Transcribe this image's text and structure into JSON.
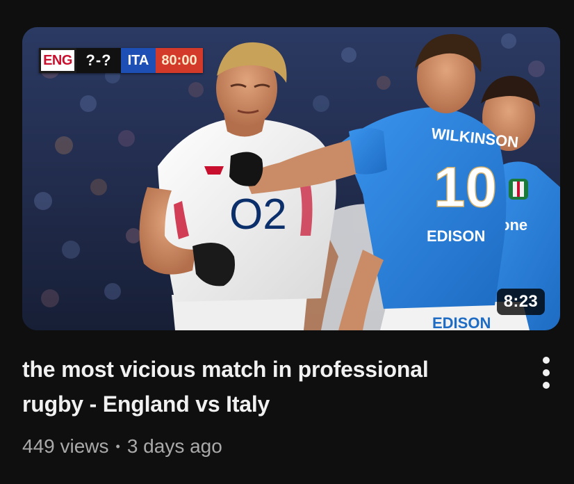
{
  "video": {
    "duration": "8:23",
    "title_line1": "the most vicious match in professional",
    "title_line2": "rugby - England vs Italy",
    "views": "449 views",
    "separator": "•",
    "age": "3 days ago"
  },
  "scorebug": {
    "home": "ENG",
    "score": "?-?",
    "away": "ITA",
    "clock": "80:00"
  },
  "thumbnail_text": {
    "jersey_name": "WILKINSON",
    "jersey_number": "10",
    "o2_logo": "O2",
    "sponsor_chest": "EDISON",
    "sponsor_shorts": "EDISON",
    "sleeve_text": "one"
  },
  "icons": {
    "menu": "more-vert-icon"
  },
  "colors": {
    "background": "#0f0f0f",
    "italy_blue": "#2a7fd6",
    "england_white": "#f2f2f2",
    "clock_red": "#d43a2a"
  }
}
